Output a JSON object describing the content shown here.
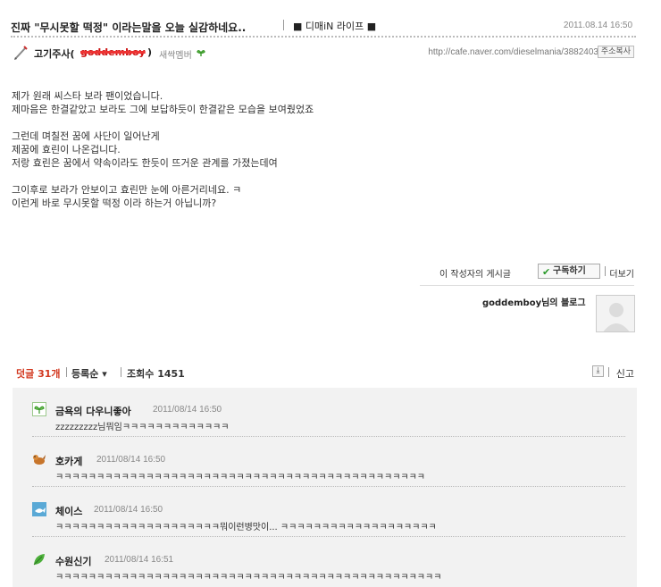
{
  "post": {
    "title": "진짜 \"무시못할 떡정\" 이라는말을 오늘 실감하네요..",
    "category": "■ 디매iN 라이프 ■",
    "date": "2011.08.14 16:50"
  },
  "author": {
    "name": "고기주사(",
    "id": "goddemboy",
    "paren": ")",
    "level": "새싹멤버",
    "url": "http://cafe.naver.com/dieselmania/3882403",
    "copy_label": "주소복사"
  },
  "body": {
    "lines": [
      "제가 원래 씨스타 보라 팬이었습니다.",
      "제마음은 한결같았고 보라도 그에 보답하듯이 한결같은 모습을 보여줬었죠",
      "",
      "그런데 며칠전 꿈에 사단이 일어난게",
      "제꿈에 효린이 나온겁니다.",
      "저랑 효린은 꿈에서 약속이라도 한듯이 뜨거운 관계를 가졌는데여",
      "",
      "그이후로 보라가 안보이고 효린만 눈에 아른거리네요. ㅋ",
      "이런게 바로 무시못할 떡정 이라 하는거 아닙니까?"
    ]
  },
  "subscribe": {
    "label": "이 작성자의 게시글",
    "button": "구독하기",
    "more": "더보기"
  },
  "blog": {
    "link": "goddemboy님의 블로그"
  },
  "comment_header": {
    "count": "덧글 31개",
    "sort": "등록순 ▾",
    "views_label": "조회수 1451",
    "report": "신고"
  },
  "comments": [
    {
      "name": "금욕의 다우니좋아",
      "date": "2011/08/14 16:50",
      "text": "zzzzzzzzz님뭐임ㅋㅋㅋㅋㅋㅋㅋㅋㅋㅋㅋㅋㅋ",
      "icon": "sprout-icon"
    },
    {
      "name": "호카게",
      "date": "2011/08/14 16:50",
      "text": "ㅋㅋㅋㅋㅋㅋㅋㅋㅋㅋㅋㅋㅋㅋㅋㅋㅋㅋㅋㅋㅋㅋㅋㅋㅋㅋㅋㅋㅋㅋㅋㅋㅋㅋㅋㅋㅋㅋㅋㅋㅋㅋㅋㅋㅋ",
      "icon": "dog-icon"
    },
    {
      "name": "체이스",
      "date": "2011/08/14 16:50",
      "text": "ㅋㅋㅋㅋㅋㅋㅋㅋㅋㅋㅋㅋㅋㅋㅋㅋㅋㅋㅋㅋ뭐이런병맛이... ㅋㅋㅋㅋㅋㅋㅋㅋㅋㅋㅋㅋㅋㅋㅋㅋㅋㅋㅋ",
      "icon": "fish-icon"
    },
    {
      "name": "수원신기",
      "date": "2011/08/14 16:51",
      "text": "ㅋㅋㅋㅋㅋㅋㅋㅋㅋㅋㅋㅋㅋㅋㅋㅋㅋㅋㅋㅋㅋㅋㅋㅋㅋㅋㅋㅋㅋㅋㅋㅋㅋㅋㅋㅋㅋㅋㅋㅋㅋㅋㅋㅋㅋㅋㅋ",
      "icon": "leaf-icon"
    }
  ],
  "colors": {
    "comment_count": "#d2381f",
    "comment_bg": "#f2f2f2",
    "strike": "#ee3333"
  }
}
